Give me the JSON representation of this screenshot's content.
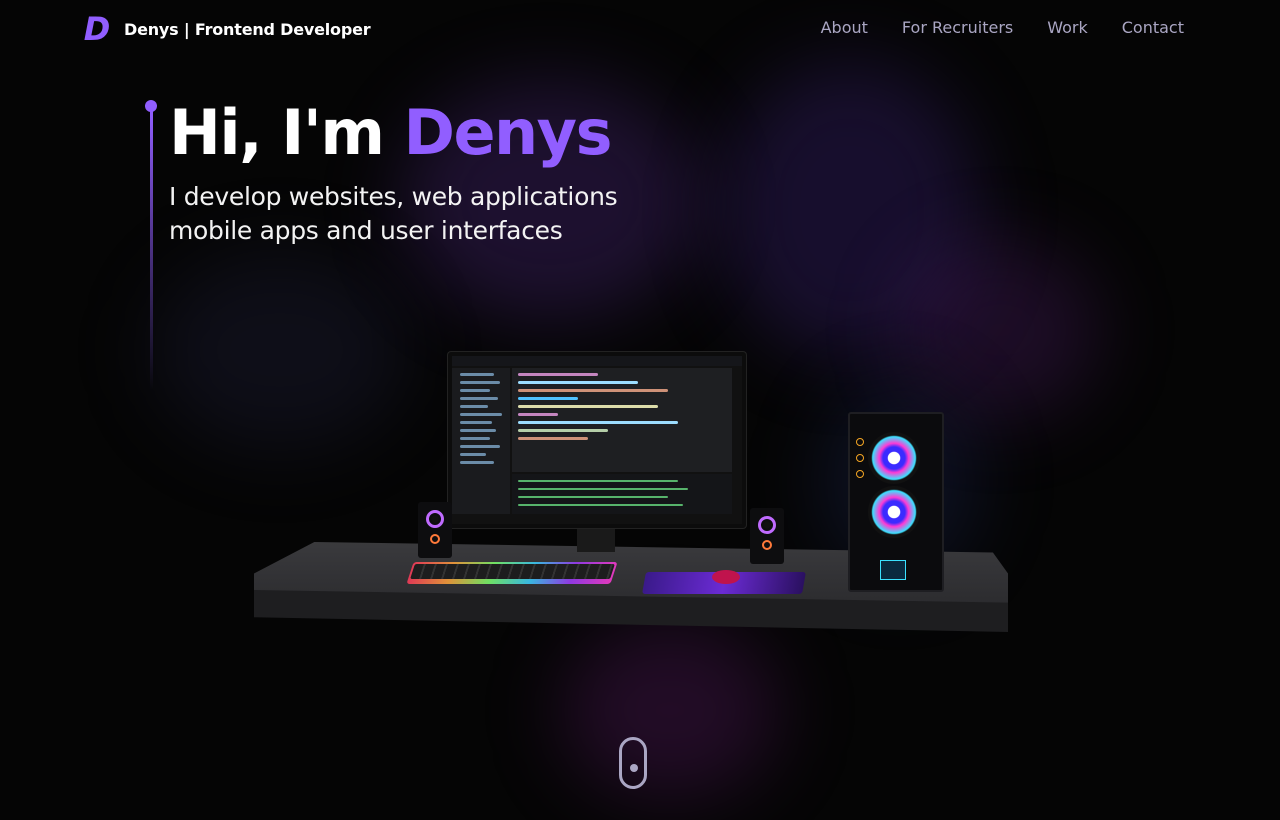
{
  "header": {
    "logo_letter": "D",
    "logo_text": "Denys | Frontend Developer",
    "nav": [
      "About",
      "For Recruiters",
      "Work",
      "Contact"
    ]
  },
  "hero": {
    "greeting": "Hi, I'm ",
    "name": "Denys",
    "subtitle_line1": "I develop websites, web applications",
    "subtitle_line2": "mobile apps and user interfaces"
  },
  "colors": {
    "accent": "#915eff",
    "nav_text": "#aaa6c3",
    "background": "#050505"
  },
  "icons": {
    "logo": "letter-d-logo",
    "scroll": "mouse-scroll-icon"
  }
}
